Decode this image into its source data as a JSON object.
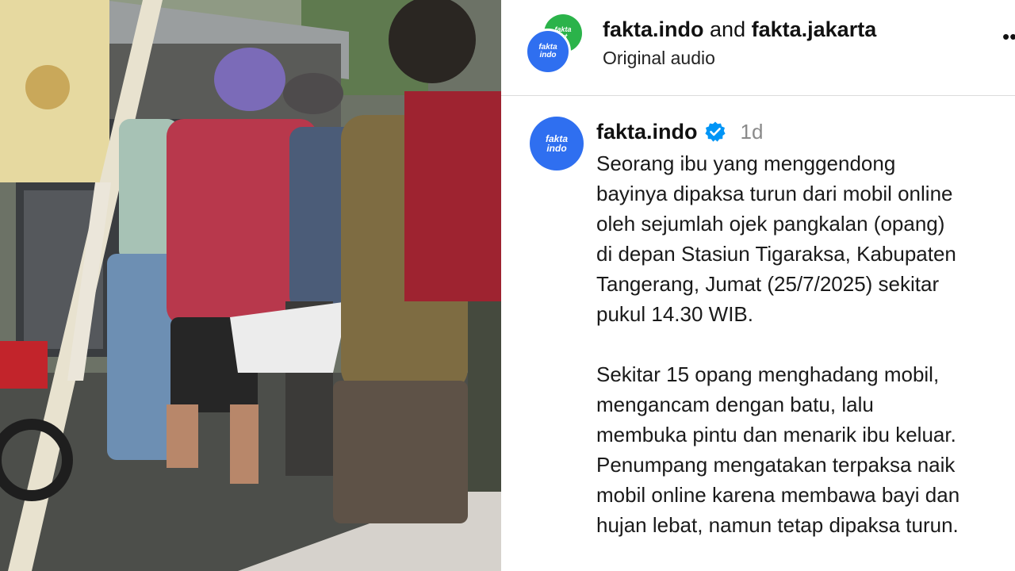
{
  "audio_header": {
    "account_primary": "fakta.indo",
    "conjunction": "and",
    "account_secondary": "fakta.jakarta",
    "audio_label": "Original audio",
    "avatar_back_text": "fakta\njkt",
    "avatar_front_text": "fakta\nindo",
    "more_icon": "more-horizontal-icon"
  },
  "post": {
    "avatar_text": "fakta\nindo",
    "author": "fakta.indo",
    "verified_icon": "verified-badge-icon",
    "time": "1d",
    "paragraphs": [
      "Seorang ibu yang menggendong\nbayinya dipaksa turun dari mobil online\noleh sejumlah ojek pangkalan (opang)\ndi depan Stasiun Tigaraksa, Kabupaten\nTangerang, Jumat (25/7/2025) sekitar\npukul 14.30 WIB.",
      "Sekitar 15 opang menghadang mobil,\nmengancam dengan batu, lalu\nmembuka pintu dan menarik ibu keluar.\nPenumpang mengatakan terpaksa naik\nmobil online karena membawa bayi dan\nhujan lebat, namun tetap dipaksa turun."
    ]
  },
  "colors": {
    "brand_blue": "#2f6ff0",
    "brand_green": "#2bb34a",
    "verified_blue": "#0095f6",
    "muted_text": "#8a8a8a",
    "divider": "#dbdbdb"
  }
}
